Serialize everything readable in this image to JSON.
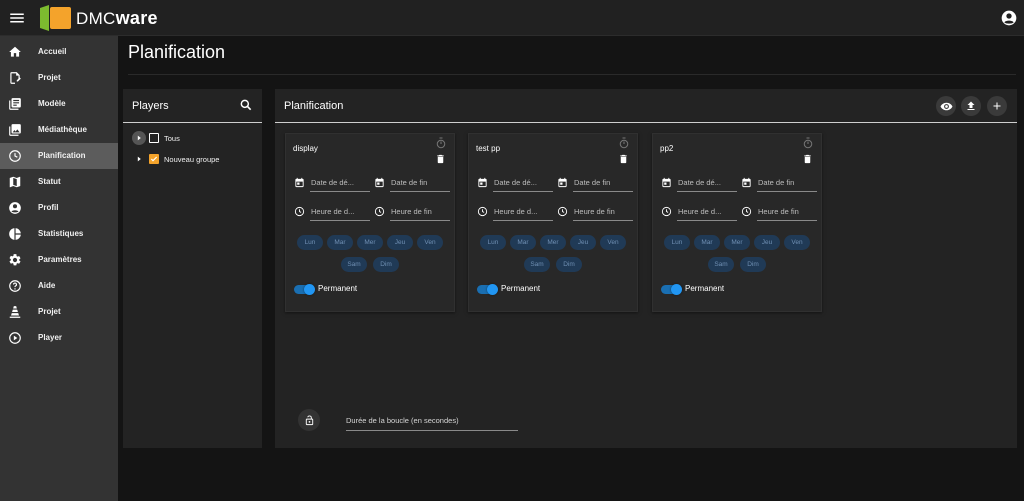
{
  "app": {
    "logo_prefix": "DMC",
    "logo_suffix": "ware",
    "accent": "#f4a32b",
    "logo_green": "#7dbb2f"
  },
  "sidebar": {
    "active_index": 4,
    "items": [
      {
        "label": "Accueil",
        "icon": "home-icon"
      },
      {
        "label": "Projet",
        "icon": "edit-document-icon"
      },
      {
        "label": "Modèle",
        "icon": "template-list-icon"
      },
      {
        "label": "Médiathèque",
        "icon": "media-library-icon"
      },
      {
        "label": "Planification",
        "icon": "clock-icon"
      },
      {
        "label": "Statut",
        "icon": "map-icon"
      },
      {
        "label": "Profil",
        "icon": "account-circle-icon"
      },
      {
        "label": "Statistiques",
        "icon": "pie-chart-icon"
      },
      {
        "label": "Paramètres",
        "icon": "gear-icon"
      },
      {
        "label": "Aide",
        "icon": "help-icon"
      },
      {
        "label": "Projet",
        "icon": "cone-icon"
      },
      {
        "label": "Player",
        "icon": "play-circle-icon"
      }
    ]
  },
  "page": {
    "title": "Planification"
  },
  "players": {
    "title": "Players",
    "tree": [
      {
        "label": "Tous",
        "checked": false
      },
      {
        "label": "Nouveau groupe",
        "checked": true
      }
    ]
  },
  "schedule": {
    "title": "Planification",
    "fields": {
      "start_date": "Date de dé...",
      "end_date": "Date de fin",
      "start_time": "Heure de d...",
      "end_time": "Heure de fin"
    },
    "days": [
      "Lun",
      "Mar",
      "Mer",
      "Jeu",
      "Ven",
      "Sam",
      "Dim"
    ],
    "permanent_label": "Permanent",
    "cards": [
      {
        "name": "display",
        "permanent": true
      },
      {
        "name": "test pp",
        "permanent": true
      },
      {
        "name": "pp2",
        "permanent": true
      }
    ],
    "loop_label": "Durée de la boucle (en secondes)"
  }
}
